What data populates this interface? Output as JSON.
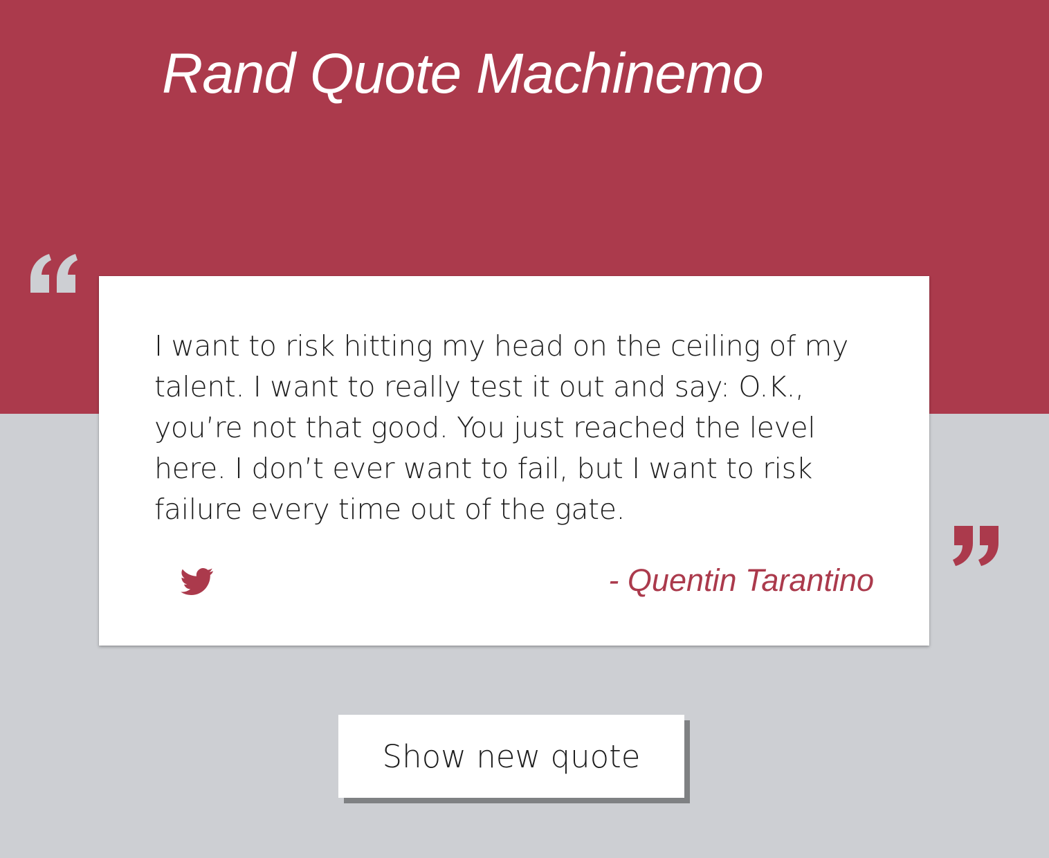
{
  "app": {
    "title": "Rand Quote Machinemo"
  },
  "icons": {
    "open_quote": "left-double-quote",
    "close_quote": "right-double-quote",
    "tweet": "twitter-icon"
  },
  "quote": {
    "text": "I want to risk hitting my head on the ceiling of my talent. I want to really test it out and say: O.K., you’re not that good. You just reached the level here. I don’t ever want to fail, but I want to risk failure every time out of the gate.",
    "author": "- Quentin Tarantino"
  },
  "actions": {
    "show_new_quote": "Show new quote"
  },
  "colors": {
    "accent": "#ab3a4c",
    "background_lower": "#cdcfd3",
    "quote_mark_light": "#cdcfd3",
    "card_background": "#ffffff",
    "text_dark": "#1d1d1d"
  }
}
